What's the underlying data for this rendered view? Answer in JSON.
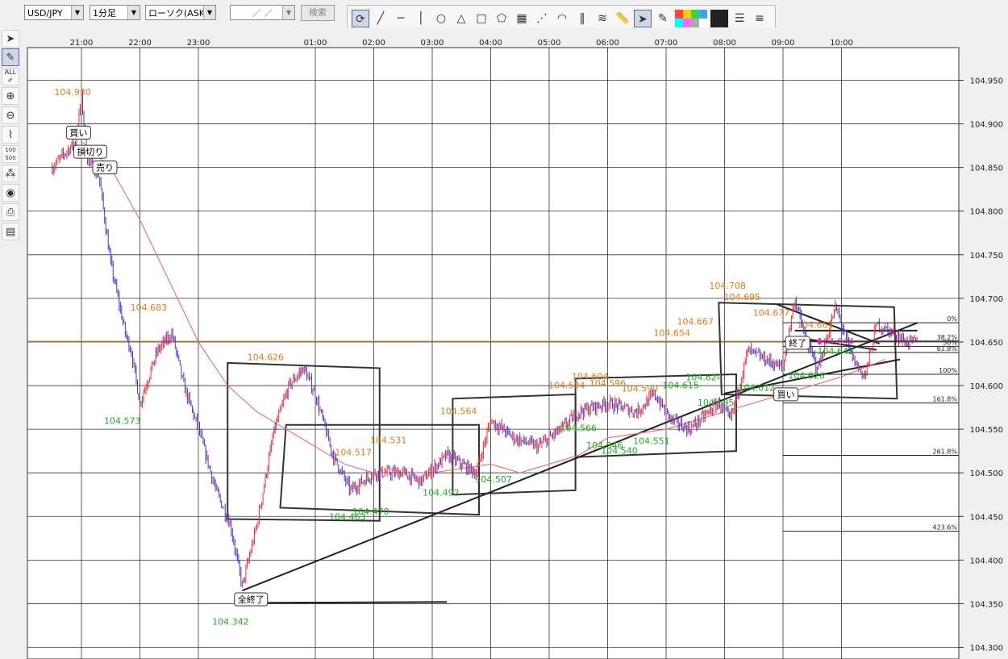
{
  "toolbar": {
    "symbol": "USD/JPY",
    "timeframe": "1分足",
    "candle_type": "ローソク(ASK)",
    "date_placeholder": "／ ／",
    "search_label": "検索",
    "palette_colors": [
      "#ff4444",
      "#ffcc00",
      "#44cc44",
      "#33aaff",
      "#00ffff",
      "#ff66ff",
      "#aaaaaa",
      "#ffffff"
    ]
  },
  "chart_data": {
    "type": "candlestick",
    "x_tick_labels": [
      "21:00",
      "22:00",
      "23:00",
      "01:00",
      "02:00",
      "03:00",
      "04:00",
      "05:00",
      "06:00",
      "07:00",
      "08:00",
      "09:00",
      "10:00"
    ],
    "y_tick_labels": [
      "104.950",
      "104.900",
      "104.850",
      "104.800",
      "104.750",
      "104.700",
      "104.650",
      "104.600",
      "104.550",
      "104.500",
      "104.450",
      "104.400",
      "104.350",
      "104.300"
    ],
    "ylim": [
      104.3,
      104.95
    ],
    "series": [
      {
        "approx_path": [
          [
            20.5,
            104.85
          ],
          [
            20.9,
            104.88
          ],
          [
            21.0,
            104.93
          ],
          [
            21.1,
            104.86
          ],
          [
            21.3,
            104.84
          ],
          [
            21.5,
            104.74
          ],
          [
            21.75,
            104.66
          ],
          [
            21.85,
            104.64
          ],
          [
            22.0,
            104.58
          ],
          [
            22.3,
            104.64
          ],
          [
            22.55,
            104.66
          ],
          [
            22.75,
            104.6
          ],
          [
            23.0,
            104.55
          ],
          [
            23.3,
            104.48
          ],
          [
            23.55,
            104.44
          ],
          [
            23.75,
            104.37
          ],
          [
            24.0,
            104.44
          ],
          [
            24.3,
            104.55
          ],
          [
            24.55,
            104.6
          ],
          [
            24.8,
            104.62
          ],
          [
            25.0,
            104.59
          ],
          [
            25.3,
            104.52
          ],
          [
            25.6,
            104.48
          ],
          [
            26.0,
            104.5
          ],
          [
            26.5,
            104.5
          ],
          [
            26.8,
            104.49
          ],
          [
            27.25,
            104.52
          ],
          [
            27.5,
            104.51
          ],
          [
            27.75,
            104.5
          ],
          [
            28.0,
            104.56
          ],
          [
            28.4,
            104.54
          ],
          [
            28.8,
            104.53
          ],
          [
            29.2,
            104.55
          ],
          [
            29.5,
            104.57
          ],
          [
            30.0,
            104.58
          ],
          [
            30.5,
            104.57
          ],
          [
            30.8,
            104.59
          ],
          [
            31.1,
            104.56
          ],
          [
            31.4,
            104.55
          ],
          [
            31.9,
            104.58
          ],
          [
            32.1,
            104.56
          ],
          [
            32.4,
            104.64
          ],
          [
            32.7,
            104.63
          ],
          [
            33.0,
            104.62
          ],
          [
            33.2,
            104.7
          ],
          [
            33.4,
            104.65
          ],
          [
            33.6,
            104.62
          ],
          [
            33.9,
            104.69
          ],
          [
            34.0,
            104.67
          ],
          [
            34.2,
            104.63
          ],
          [
            34.4,
            104.61
          ],
          [
            34.6,
            104.67
          ],
          [
            34.9,
            104.66
          ],
          [
            35.1,
            104.65
          ],
          [
            35.3,
            104.65
          ]
        ]
      },
      {
        "name": "",
        "approx_path": [
          [
            21.0,
            104.88
          ],
          [
            21.5,
            104.85
          ],
          [
            22.0,
            104.79
          ],
          [
            22.5,
            104.72
          ],
          [
            23.0,
            104.65
          ],
          [
            23.5,
            104.6
          ],
          [
            24.0,
            104.57
          ],
          [
            24.5,
            104.55
          ],
          [
            25.0,
            104.53
          ],
          [
            25.5,
            104.51
          ],
          [
            26.0,
            104.5
          ],
          [
            27.0,
            104.5
          ],
          [
            28.0,
            104.51
          ],
          [
            28.5,
            104.5
          ],
          [
            29.0,
            104.51
          ],
          [
            29.5,
            104.52
          ],
          [
            30.0,
            104.54
          ],
          [
            31.0,
            104.55
          ],
          [
            32.0,
            104.57
          ],
          [
            33.0,
            104.59
          ],
          [
            34.0,
            104.61
          ],
          [
            34.75,
            104.63
          ]
        ]
      }
    ],
    "price_labels": [
      {
        "text": "104.930",
        "time": 20.85,
        "price": 104.933,
        "kind": "high"
      },
      {
        "text": "104.683",
        "time": 22.15,
        "price": 104.686,
        "kind": "high"
      },
      {
        "text": "104.573",
        "time": 21.7,
        "price": 104.556,
        "kind": "low"
      },
      {
        "text": "104.626",
        "time": 24.15,
        "price": 104.629,
        "kind": "high"
      },
      {
        "text": "104.342",
        "time": 23.55,
        "price": 104.326,
        "kind": "low"
      },
      {
        "text": "104.517",
        "time": 25.65,
        "price": 104.52,
        "kind": "high"
      },
      {
        "text": "104.463",
        "time": 25.55,
        "price": 104.446,
        "kind": "low"
      },
      {
        "text": "104.470",
        "time": 25.95,
        "price": 104.452,
        "kind": "low"
      },
      {
        "text": "104.531",
        "time": 26.25,
        "price": 104.534,
        "kind": "high"
      },
      {
        "text": "104.492",
        "time": 27.15,
        "price": 104.474,
        "kind": "low"
      },
      {
        "text": "104.564",
        "time": 27.45,
        "price": 104.567,
        "kind": "high"
      },
      {
        "text": "104.507",
        "time": 28.05,
        "price": 104.489,
        "kind": "low"
      },
      {
        "text": "104.604",
        "time": 29.7,
        "price": 104.607,
        "kind": "high"
      },
      {
        "text": "104.594",
        "time": 29.3,
        "price": 104.597,
        "kind": "high"
      },
      {
        "text": "104.596",
        "time": 30.0,
        "price": 104.599,
        "kind": "high"
      },
      {
        "text": "104.590",
        "time": 30.55,
        "price": 104.593,
        "kind": "high"
      },
      {
        "text": "104.566",
        "time": 29.5,
        "price": 104.548,
        "kind": "low"
      },
      {
        "text": "104.546",
        "time": 29.95,
        "price": 104.528,
        "kind": "low"
      },
      {
        "text": "104.540",
        "time": 30.2,
        "price": 104.522,
        "kind": "low"
      },
      {
        "text": "104.551",
        "time": 30.75,
        "price": 104.533,
        "kind": "low"
      },
      {
        "text": "104.654",
        "time": 31.1,
        "price": 104.657,
        "kind": "high"
      },
      {
        "text": "104.667",
        "time": 31.5,
        "price": 104.67,
        "kind": "high"
      },
      {
        "text": "104.708",
        "time": 32.05,
        "price": 104.711,
        "kind": "high"
      },
      {
        "text": "104.695",
        "time": 32.3,
        "price": 104.698,
        "kind": "high"
      },
      {
        "text": "104.677",
        "time": 32.8,
        "price": 104.68,
        "kind": "high"
      },
      {
        "text": "104.615",
        "time": 31.25,
        "price": 104.597,
        "kind": "low"
      },
      {
        "text": "104.624",
        "time": 31.65,
        "price": 104.606,
        "kind": "low"
      },
      {
        "text": "104.595",
        "time": 31.85,
        "price": 104.577,
        "kind": "low"
      },
      {
        "text": "104.612",
        "time": 32.55,
        "price": 104.594,
        "kind": "low"
      },
      {
        "text": "104.626",
        "time": 33.4,
        "price": 104.608,
        "kind": "low"
      },
      {
        "text": "104.663",
        "time": 33.55,
        "price": 104.666,
        "kind": "high"
      },
      {
        "text": "104.644",
        "time": 33.9,
        "price": 104.647,
        "kind": "current"
      },
      {
        "text": "104.642",
        "time": 33.9,
        "price": 104.636,
        "kind": "low"
      }
    ],
    "trade_markers": [
      {
        "text": "買い",
        "time": 20.95,
        "price": 104.89
      },
      {
        "text": "損切り",
        "time": 21.15,
        "price": 104.868
      },
      {
        "text": "売り",
        "time": 21.4,
        "price": 104.85
      },
      {
        "text": "全終了",
        "time": 23.9,
        "price": 104.355
      },
      {
        "text": "終了",
        "time": 33.25,
        "price": 104.649
      },
      {
        "text": "買い",
        "time": 33.05,
        "price": 104.59
      }
    ],
    "fibonacci_levels": [
      {
        "label": "0%",
        "price": 104.672
      },
      {
        "label": "38.2%",
        "price": 104.651
      },
      {
        "label": "50%",
        "price": 104.645
      },
      {
        "label": "61.8%",
        "price": 104.638
      },
      {
        "label": "100%",
        "price": 104.613
      },
      {
        "label": "161.8%",
        "price": 104.58
      },
      {
        "label": "261.8%",
        "price": 104.52
      },
      {
        "label": "423.6%",
        "price": 104.433
      }
    ],
    "horizontal_line_price": 104.651,
    "colors": {
      "bull": "#e8303a",
      "bear": "#3b3bcc",
      "ma": "#e87878",
      "high_label": "#e07b1a",
      "low_label": "#22aa22",
      "current_label": "#e0289a",
      "hline": "#f0a040"
    }
  }
}
